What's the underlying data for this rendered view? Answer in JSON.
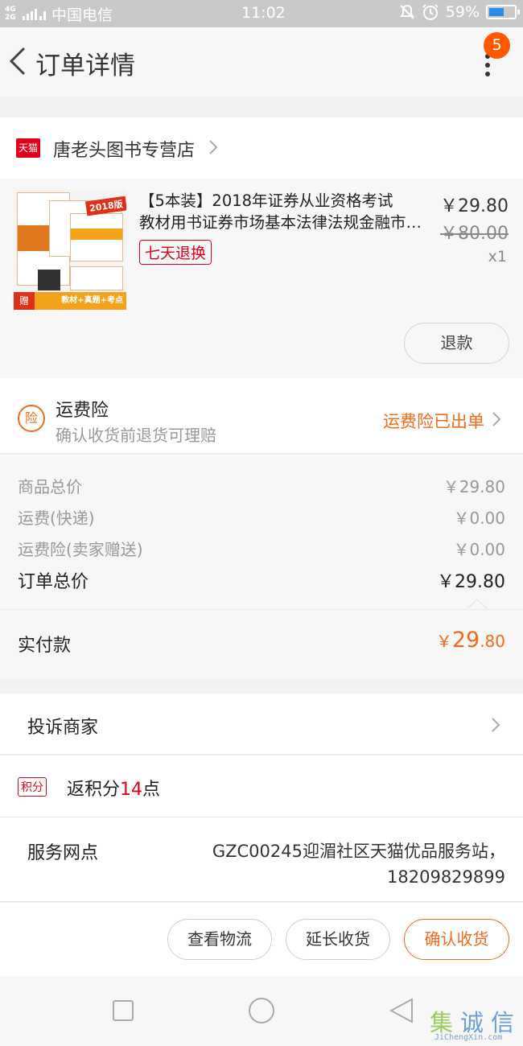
{
  "status_bar": {
    "network": "4G",
    "network2": "2G",
    "carrier": "中国电信",
    "time": "11:02",
    "battery": "59%",
    "battery_level": 0.59
  },
  "header": {
    "title": "订单详情",
    "badge_count": "5"
  },
  "store": {
    "logo_text": "天猫",
    "name": "唐老头图书专营店"
  },
  "product": {
    "title_line1": "【5本装】2018年证券从业资格考试",
    "title_line2": "教材用书证券市场基本法律法规金融市场基础知识",
    "return_tag": "七天退换",
    "price": "￥29.80",
    "original_price": "￥80.00",
    "quantity": "x1",
    "refund_label": "退款",
    "thumb_tag": "2018版",
    "thumb_gift": "赠",
    "thumb_bottom": "教材+真题+考点"
  },
  "insurance": {
    "icon_text": "险",
    "title": "运费险",
    "subtitle": "确认收货前退货可理赔",
    "status": "运费险已出单"
  },
  "fees": [
    {
      "label": "商品总价",
      "value": "￥29.80"
    },
    {
      "label": "运费(快递)",
      "value": "￥0.00"
    },
    {
      "label": "运费险(卖家赠送)",
      "value": "￥0.00"
    }
  ],
  "order_total": {
    "label": "订单总价",
    "value": "￥29.80"
  },
  "paid": {
    "label": "实付款",
    "currency": "￥",
    "int": "29",
    "dec": ".80"
  },
  "complain": {
    "label": "投诉商家"
  },
  "points": {
    "badge": "积分",
    "prefix": "返积分",
    "num": "14",
    "suffix": "点"
  },
  "service": {
    "label": "服务网点",
    "line1": "GZC00245迎湄社区天猫优品服务站，",
    "line2": "18209829899"
  },
  "actions": {
    "logistics": "查看物流",
    "extend": "延长收货",
    "confirm": "确认收货"
  },
  "watermark": {
    "logo": "集",
    "text1": "诚",
    "text2": "信",
    "url": "JiChengXin.com"
  },
  "colors": {
    "accent": "#ef6a1a",
    "tmall_red": "#e0001b",
    "badge": "#ff5a00"
  }
}
